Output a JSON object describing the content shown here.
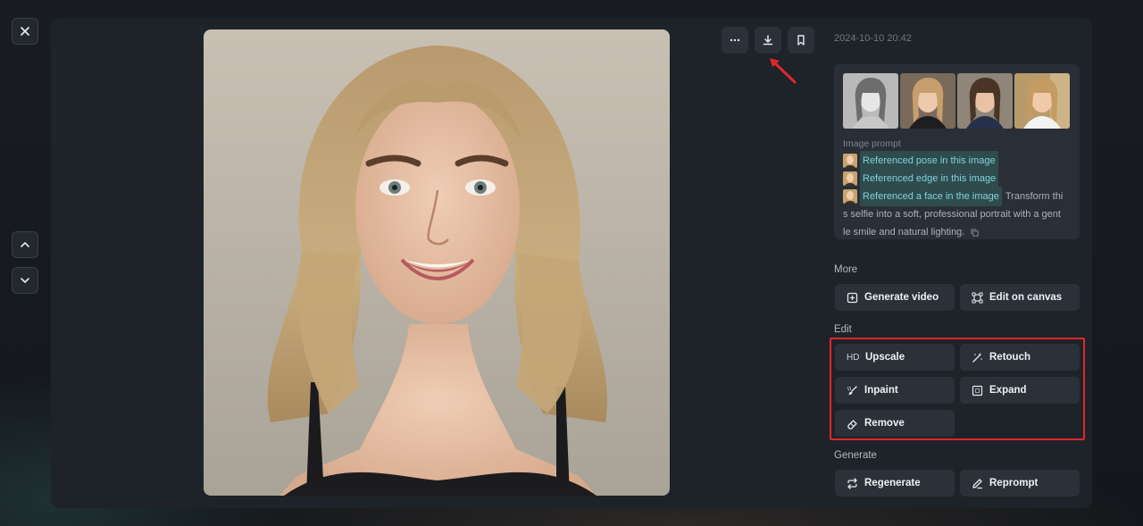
{
  "nav": {
    "close_icon": "close-icon",
    "prev_icon": "chevron-up-icon",
    "next_icon": "chevron-down-icon"
  },
  "toolbar": {
    "more_icon": "more-horizontal-icon",
    "download_icon": "download-icon",
    "bookmark_icon": "bookmark-icon"
  },
  "details": {
    "timestamp": "2024-10-10 20:42",
    "prompt_label": "Image prompt",
    "references": [
      {
        "label": "Referenced pose in this image"
      },
      {
        "label": "Referenced edge in this image"
      },
      {
        "label": "Referenced a face in the image",
        "suffix": "Transform thi"
      }
    ],
    "prompt_text_line1": "s selfie into a soft, professional portrait with a gent",
    "prompt_text_line2": "le smile and natural lighting."
  },
  "sections": {
    "more": {
      "title": "More",
      "generate_video": "Generate video",
      "edit_on_canvas": "Edit on canvas"
    },
    "edit": {
      "title": "Edit",
      "upscale_prefix": "HD",
      "upscale": "Upscale",
      "retouch": "Retouch",
      "inpaint": "Inpaint",
      "expand": "Expand",
      "remove": "Remove"
    },
    "generate": {
      "title": "Generate",
      "regenerate": "Regenerate",
      "reprompt": "Reprompt"
    }
  },
  "colors": {
    "annotation_red": "#e0262b",
    "chip_text": "#7fd3d8",
    "chip_bg": "#2f4b4e"
  }
}
